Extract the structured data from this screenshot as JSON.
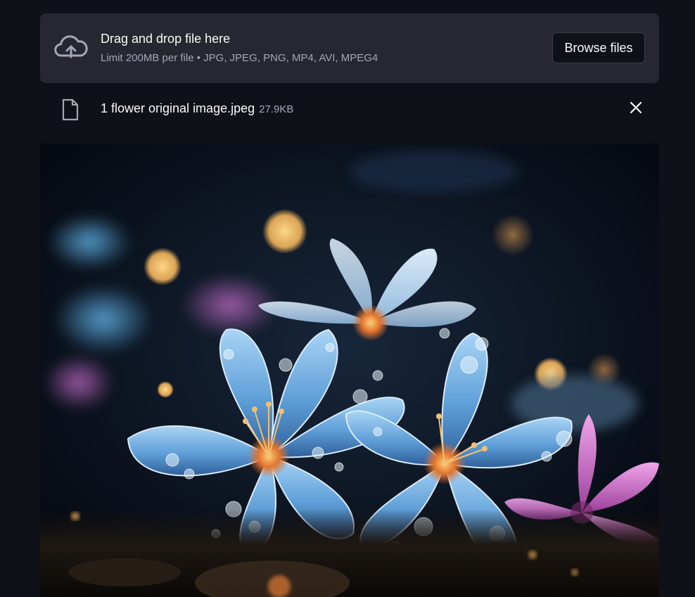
{
  "uploader": {
    "title": "Drag and drop file here",
    "limits": "Limit 200MB per file • JPG, JPEG, PNG, MP4, AVI, MPEG4",
    "browse_label": "Browse files",
    "icon": "cloud-upload-icon"
  },
  "file": {
    "name": "1 flower original image.jpeg",
    "size": "27.9KB",
    "icon": "file-icon",
    "remove_icon": "close-icon"
  },
  "preview": {
    "subject": "flower-photo",
    "colors": {
      "background": "#05070c",
      "petal_blue": "#7fb8e8",
      "petal_pink": "#d98ad6",
      "bokeh_gold": "#f5c06a"
    }
  },
  "theme": {
    "page_bg": "#0e1117",
    "panel_bg": "#262730",
    "text": "#fafafa",
    "muted_text": "#a3a8b8"
  }
}
